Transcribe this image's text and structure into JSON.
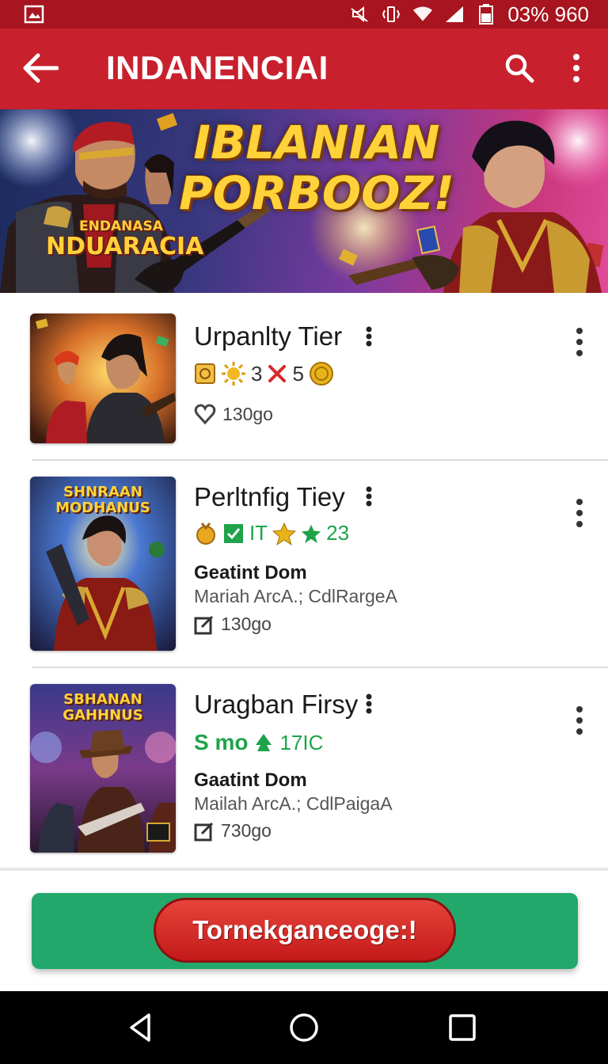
{
  "status_bar": {
    "time_text": "03% 960",
    "icons": [
      "gallery-icon",
      "mute-icon",
      "vibrate-icon",
      "wifi-icon",
      "signal-icon",
      "battery-icon"
    ]
  },
  "app_bar": {
    "title": "INDANENCIAI",
    "back_icon": "arrow-left-icon",
    "search_icon": "search-icon",
    "menu_icon": "more-vertical-icon"
  },
  "banner": {
    "headline_line1": "IBLANIAN",
    "headline_line2": "PORBOOZ!",
    "badge_line1": "ENDANASA",
    "badge_line2": "NDUARACIA"
  },
  "items": [
    {
      "title": "Urpanlty Tier",
      "meta_a": "3",
      "meta_b": "5",
      "stat": "130go",
      "thumb_caption_1": "",
      "thumb_caption_2": ""
    },
    {
      "title": "Perltnfig Tiey",
      "meta_a": "IT",
      "meta_b": "23",
      "developer": "Geatint Dom",
      "subtitle": "Mariah ArcA.; CdlRargeA",
      "stat": "130go",
      "thumb_caption_1": "SHNRAAN",
      "thumb_caption_2": "MODHANUS"
    },
    {
      "title": "Uragban Firsy",
      "meta_a": "S mo",
      "meta_b": "17IC",
      "developer": "Gaatint Dom",
      "subtitle": "Mailah ArcA.; CdlPaigaA",
      "stat": "730go",
      "thumb_caption_1": "SBHANAN",
      "thumb_caption_2": "GAHHNUS"
    }
  ],
  "cta": {
    "label": "Tornekganceoge:!"
  },
  "nav": {
    "back": "nav-back-icon",
    "home": "nav-home-icon",
    "recents": "nav-recents-icon"
  },
  "colors": {
    "status_bar": "#a8141f",
    "app_bar": "#c8202d",
    "cta_bar": "#23a86b",
    "cta_button": "#d42a24",
    "meta_green": "#1fa34a",
    "star_gold": "#e8b21a"
  }
}
